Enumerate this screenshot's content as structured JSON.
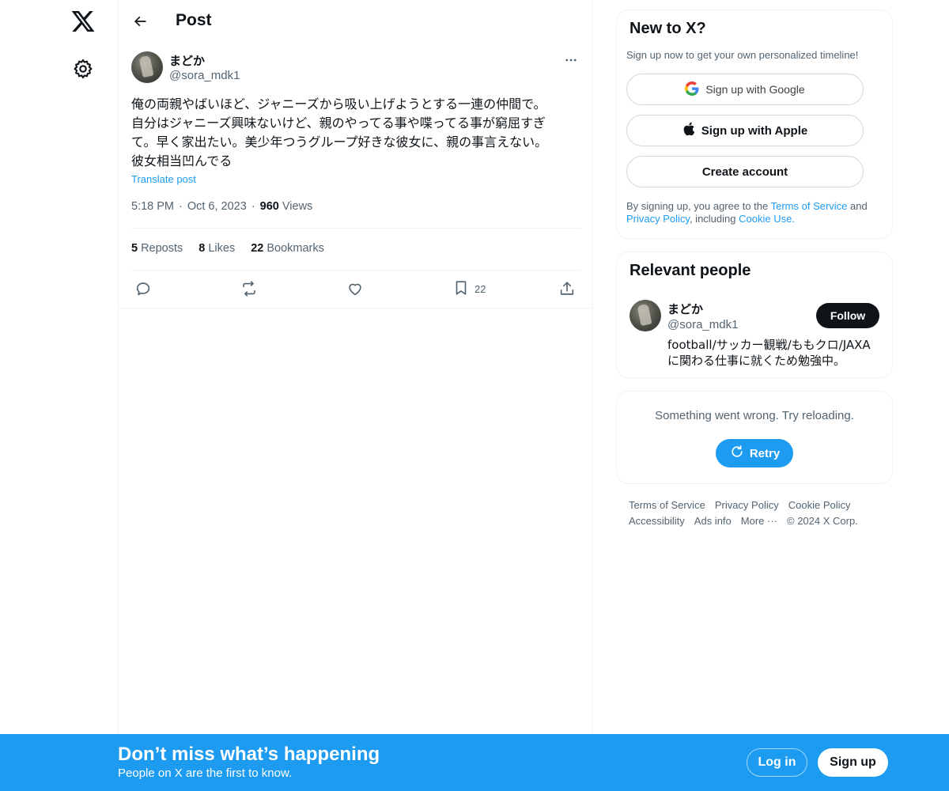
{
  "nav": {
    "logo_icon": "x-logo-icon",
    "settings_icon": "gear-icon"
  },
  "header": {
    "title": "Post"
  },
  "post": {
    "author_name": "まどか",
    "author_handle": "@sora_mdk1",
    "text": "俺の両親やばいほど、ジャニーズから吸い上げようとする一連の仲間で。\n自分はジャニーズ興味ないけど、親のやってる事や喋ってる事が窮屈すぎ\nて。早く家出たい。美少年つうグループ好きな彼女に、親の事言えない。\n彼女相当凹んでる",
    "translate_label": "Translate post",
    "time": "5:18 PM",
    "date": "Oct 6, 2023",
    "views_count": "960",
    "views_label": "Views",
    "reposts_count": "5",
    "reposts_label": "Reposts",
    "likes_count": "8",
    "likes_label": "Likes",
    "bookmarks_count": "22",
    "bookmarks_label": "Bookmarks",
    "bookmark_action_count": "22"
  },
  "signup_card": {
    "title": "New to X?",
    "subtitle": "Sign up now to get your own personalized timeline!",
    "google_label": "Sign up with Google",
    "apple_label": "Sign up with Apple",
    "create_label": "Create account",
    "legal_prefix": "By signing up, you agree to the ",
    "terms_label": "Terms of Service",
    "legal_and": " and ",
    "privacy_label": "Privacy Policy",
    "legal_including": ", including ",
    "cookie_label": "Cookie Use."
  },
  "relevant_people": {
    "title": "Relevant people",
    "name": "まどか",
    "handle": "@sora_mdk1",
    "follow_label": "Follow",
    "bio": "football/サッカー観戦/ももクロ/JAXAに関わる仕事に就くため勉強中。"
  },
  "error_card": {
    "message": "Something went wrong. Try reloading.",
    "retry_label": "Retry"
  },
  "footer": {
    "terms": "Terms of Service",
    "privacy": "Privacy Policy",
    "cookie": "Cookie Policy",
    "accessibility": "Accessibility",
    "ads": "Ads info",
    "more": "More ···",
    "copyright": "© 2024 X Corp."
  },
  "bottom_bar": {
    "title": "Don’t miss what’s happening",
    "subtitle": "People on X are the first to know.",
    "login_label": "Log in",
    "signup_label": "Sign up"
  },
  "colors": {
    "accent": "#1d9bf0",
    "text": "#0f1419",
    "secondary": "#536471",
    "border": "#eff3f4"
  }
}
